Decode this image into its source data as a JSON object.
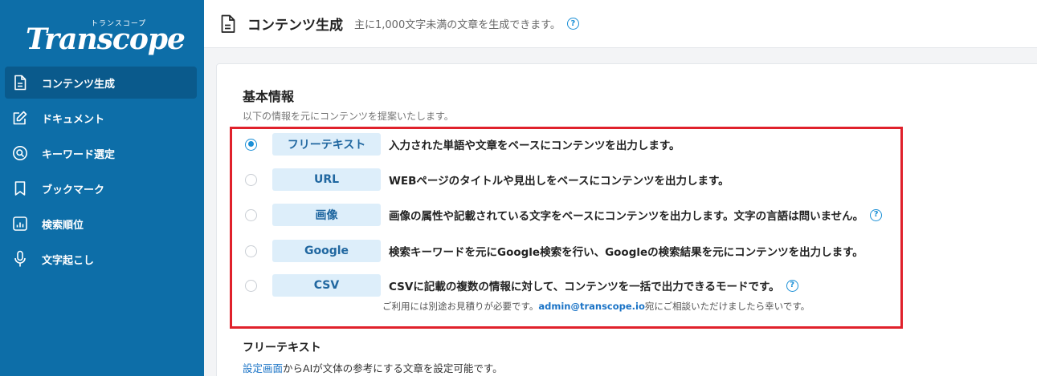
{
  "brand": {
    "ruby": "トランスコープ",
    "name": "Transcope"
  },
  "sidebar": {
    "items": [
      {
        "label": "コンテンツ生成",
        "icon": "document-icon",
        "active": true
      },
      {
        "label": "ドキュメント",
        "icon": "edit-icon",
        "active": false
      },
      {
        "label": "キーワード選定",
        "icon": "search-icon",
        "active": false
      },
      {
        "label": "ブックマーク",
        "icon": "bookmark-icon",
        "active": false
      },
      {
        "label": "検索順位",
        "icon": "chart-icon",
        "active": false
      },
      {
        "label": "文字起こし",
        "icon": "microphone-icon",
        "active": false
      }
    ]
  },
  "header": {
    "title": "コンテンツ生成",
    "subtitle": "主に1,000文字未満の文章を生成できます。",
    "help": "?"
  },
  "basic_info": {
    "title": "基本情報",
    "description": "以下の情報を元にコンテンツを提案いたします。",
    "options": [
      {
        "tag": "フリーテキスト",
        "desc": "入力された単語や文章をベースにコンテンツを出力します。",
        "selected": true
      },
      {
        "tag": "URL",
        "desc": "WEBページのタイトルや見出しをベースにコンテンツを出力します。",
        "selected": false
      },
      {
        "tag": "画像",
        "desc": "画像の属性や記載されている文字をベースにコンテンツを出力します。文字の言語は問いません。",
        "selected": false
      },
      {
        "tag": "Google",
        "desc": "検索キーワードを元にGoogle検索を行い、Googleの検索結果を元にコンテンツを出力します。",
        "selected": false
      },
      {
        "tag": "CSV",
        "desc": "CSVに記載の複数の情報に対して、コンテンツを一括で出力できるモードです。",
        "selected": false
      }
    ],
    "csv_note_prefix": "ご利用には別途お見積りが必要です。",
    "csv_note_email": "admin@transcope.io",
    "csv_note_suffix": "宛にご相談いただけましたら幸いです。"
  },
  "free_text": {
    "title": "フリーテキスト",
    "link": "設定画面",
    "desc": "からAIが文体の参考にする文章を設定可能です。"
  },
  "colors": {
    "sidebar": "#0d6ea8",
    "accent": "#1a8fd6",
    "highlight": "#e0212b",
    "tag_bg": "#ddeefa"
  }
}
